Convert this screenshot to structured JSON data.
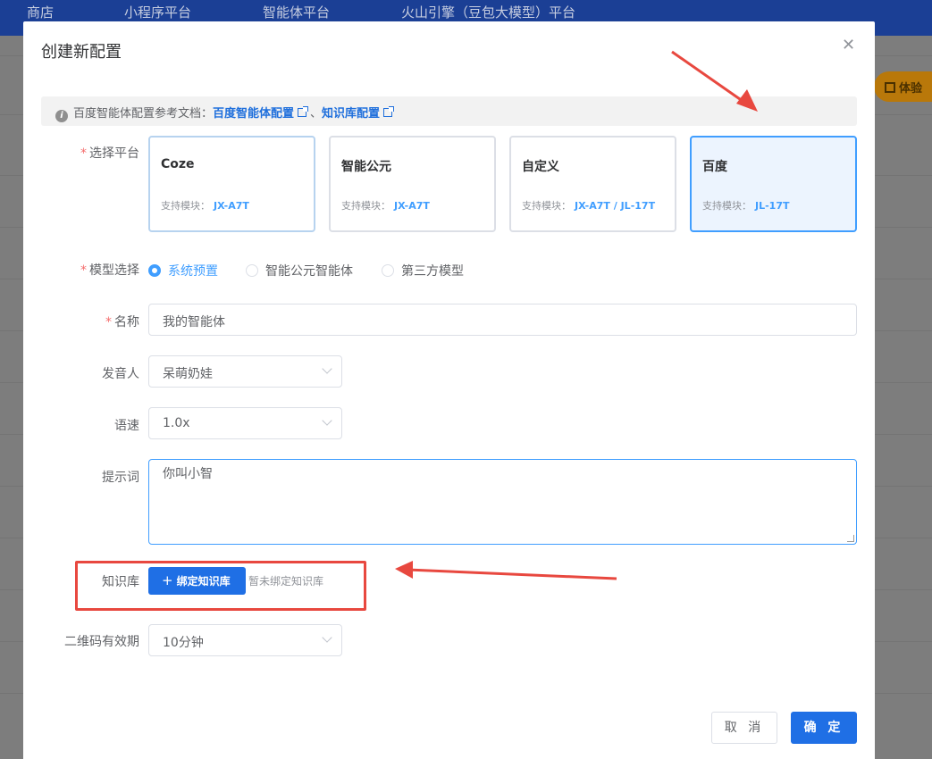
{
  "topnav": {
    "items": [
      "商店",
      "小程序平台",
      "智能体平台",
      "火山引擎（豆包大模型）平台"
    ]
  },
  "background": {
    "trial_button": "体验"
  },
  "dialog": {
    "title": "创建新配置",
    "close_icon": "close-icon",
    "reference": {
      "text": "百度智能体配置参考文档：",
      "link1": "百度智能体配置",
      "separator": "、",
      "link2": "知识库配置"
    },
    "platform": {
      "label": "选择平台",
      "support_prefix": "支持模块：",
      "cards": [
        {
          "name": "Coze",
          "modules": "JX-A7T",
          "selected": false
        },
        {
          "name": "智能公元",
          "modules": "JX-A7T",
          "selected": false
        },
        {
          "name": "自定义",
          "modules": "JX-A7T / JL-17T",
          "selected": false
        },
        {
          "name": "百度",
          "modules": "JL-17T",
          "selected": true
        }
      ]
    },
    "model": {
      "label": "模型选择",
      "options": [
        {
          "label": "系统预置",
          "checked": true
        },
        {
          "label": "智能公元智能体",
          "checked": false
        },
        {
          "label": "第三方模型",
          "checked": false
        }
      ]
    },
    "name": {
      "label": "名称",
      "value": "我的智能体"
    },
    "speaker": {
      "label": "发音人",
      "value": "呆萌奶娃"
    },
    "speed": {
      "label": "语速",
      "value": "1.0x"
    },
    "prompt": {
      "label": "提示词",
      "value": "你叫小智"
    },
    "knowledge": {
      "label": "知识库",
      "bind_button": "绑定知识库",
      "status": "暂未绑定知识库"
    },
    "qr_validity": {
      "label": "二维码有效期",
      "value": "10分钟"
    },
    "footer": {
      "cancel": "取 消",
      "confirm": "确 定"
    }
  },
  "colors": {
    "primary": "#1f6fe5",
    "selected_card_bg": "#ecf4fe",
    "annotation_red": "#e8483f",
    "required_star": "#f56c6c"
  }
}
